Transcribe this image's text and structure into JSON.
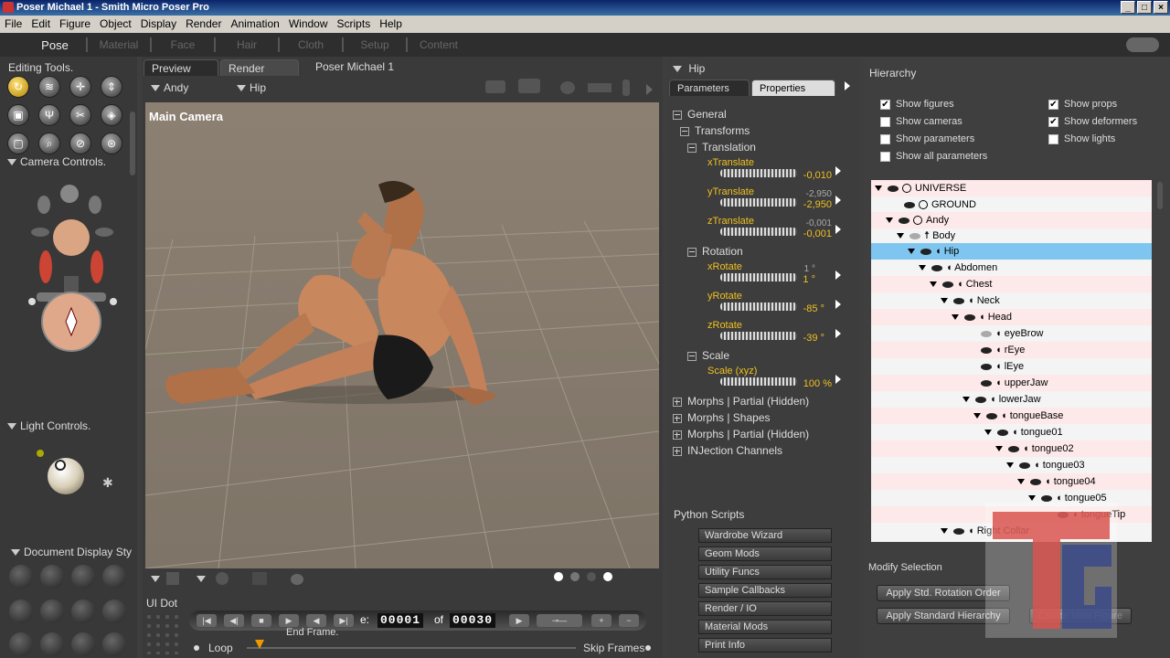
{
  "window": {
    "title": "Poser Michael 1 - Smith Micro Poser Pro"
  },
  "menu": [
    "File",
    "Edit",
    "Figure",
    "Object",
    "Display",
    "Render",
    "Animation",
    "Window",
    "Scripts",
    "Help"
  ],
  "rooms": [
    "Pose",
    "Material",
    "Face",
    "Hair",
    "Cloth",
    "Setup",
    "Content"
  ],
  "left": {
    "editing_tools": "Editing Tools.",
    "camera_controls": "Camera Controls.",
    "light_controls": "Light Controls.",
    "document_display": "Document Display Sty",
    "ui_dot": "UI Dot"
  },
  "viewport": {
    "tabs": [
      "Preview",
      "Render"
    ],
    "doc_title": "Poser Michael 1",
    "figure_menu": "Andy",
    "actor_menu": "Hip",
    "camera": "Main Camera"
  },
  "playback": {
    "frame_label": "e:",
    "current_frame": "00001",
    "of_label": "of",
    "total_frames": "00030",
    "end_frame_label": "End Frame.",
    "loop_label": "Loop",
    "skip_frames_label": "Skip Frames"
  },
  "params": {
    "actor": "Hip",
    "tabs": [
      "Parameters",
      "Properties"
    ],
    "groups": {
      "general": "General",
      "transforms": "Transforms",
      "translation": "Translation",
      "rotation": "Rotation",
      "scale": "Scale",
      "morphs1": "Morphs | Partial (Hidden)",
      "morphs2": "Morphs | Shapes",
      "morphs3": "Morphs | Partial (Hidden)",
      "injection": "INJection Channels"
    },
    "dials": [
      {
        "name": "xTranslate",
        "value": "-0,010",
        "prev": ""
      },
      {
        "name": "yTranslate",
        "value": "-2,950",
        "prev": "-2,950"
      },
      {
        "name": "zTranslate",
        "value": "-0,001",
        "prev": "-0,001"
      },
      {
        "name": "xRotate",
        "value": "1 °",
        "prev": "1 °"
      },
      {
        "name": "yRotate",
        "value": "-85 °",
        "prev": ""
      },
      {
        "name": "zRotate",
        "value": "-39 °",
        "prev": ""
      },
      {
        "name": "Scale (xyz)",
        "value": "100 %",
        "prev": ""
      }
    ]
  },
  "python": {
    "title": "Python Scripts",
    "buttons": [
      "Wardrobe Wizard",
      "Geom Mods",
      "Utility Funcs",
      "Sample Callbacks",
      "Render / IO",
      "Material Mods",
      "Print Info"
    ]
  },
  "hierarchy": {
    "title": "Hierarchy",
    "checks": [
      {
        "label": "Show figures",
        "checked": true
      },
      {
        "label": "Show props",
        "checked": true
      },
      {
        "label": "Show cameras",
        "checked": false
      },
      {
        "label": "Show deformers",
        "checked": true
      },
      {
        "label": "Show parameters",
        "checked": false
      },
      {
        "label": "Show lights",
        "checked": false
      },
      {
        "label": "Show all parameters",
        "checked": false
      }
    ],
    "tree": [
      "UNIVERSE",
      "GROUND",
      "Andy",
      "Body",
      "Hip",
      "Abdomen",
      "Chest",
      "Neck",
      "Head",
      "eyeBrow",
      "rEye",
      "lEye",
      "upperJaw",
      "lowerJaw",
      "tongueBase",
      "tongue01",
      "tongue02",
      "tongue03",
      "tongue04",
      "tongue05",
      "tongueTip",
      "Right Collar"
    ],
    "modify_title": "Modify Selection",
    "btn_rotation": "Apply Std. Rotation Order",
    "btn_hierarchy": "Apply Standard Hierarchy",
    "btn_new_figure": "Create New Figure"
  }
}
